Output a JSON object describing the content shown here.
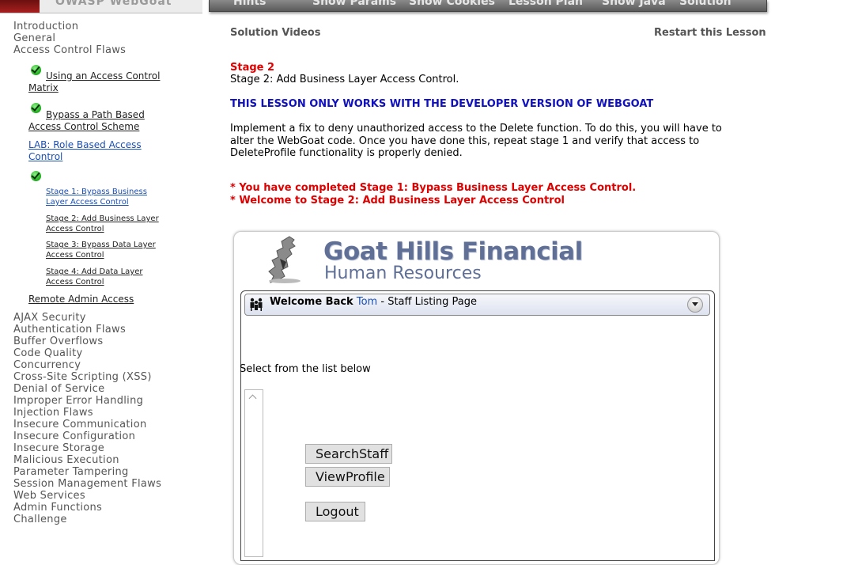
{
  "banner": {
    "top_nav": [
      "Hints",
      "Show Params",
      "Show Cookies",
      "Lesson Plan",
      "Show Java",
      "Solution"
    ]
  },
  "sidebar": {
    "top_items": [
      "Introduction",
      "General",
      "Access Control Flaws"
    ],
    "lessons": [
      "Using an Access Control Matrix",
      "Bypass a Path Based Access Control Scheme",
      "LAB: Role Based Access Control"
    ],
    "stages": [
      "Stage 1: Bypass Business Layer Access Control",
      "Stage 2: Add Business Layer Access Control",
      "Stage 3: Bypass Data Layer Access Control",
      "Stage 4: Add Data Layer Access Control"
    ],
    "remote_admin": "Remote Admin Access",
    "categories": [
      "AJAX Security",
      "Authentication Flaws",
      "Buffer Overflows",
      "Code Quality",
      "Concurrency",
      "Cross-Site Scripting (XSS)",
      "Denial of Service",
      "Improper Error Handling",
      "Injection Flaws",
      "Insecure Communication",
      "Insecure Configuration",
      "Insecure Storage",
      "Malicious Execution",
      "Parameter Tampering",
      "Session Management Flaws",
      "Web Services",
      "Admin Functions",
      "Challenge"
    ]
  },
  "main": {
    "solution_videos": "Solution Videos",
    "restart": "Restart this Lesson",
    "stage_title": "Stage 2",
    "stage_desc": "Stage 2: Add Business Layer Access Control.",
    "dev_warning": "THIS LESSON ONLY WORKS WITH THE DEVELOPER VERSION OF WEBGOAT",
    "instructions": [
      "Implement a fix to deny unauthorized access to the Delete function. To do this, you will have to",
      "alter the WebGoat code. Once you have done this, repeat stage 1 and verify that access to",
      "DeleteProfile functionality is properly denied."
    ],
    "completed_msg": "* You have completed Stage 1: Bypass Business Layer Access Control.",
    "welcome_msg": "* Welcome to Stage 2: Add Business Layer Access Control"
  },
  "app": {
    "brand_title": "Goat Hills Financial",
    "brand_sub": "Human Resources",
    "welcome_back": "Welcome Back",
    "user": "Tom",
    "sep": " - ",
    "page": "Staff Listing Page",
    "select_label": "Select from the list below",
    "buttons": {
      "search": "SearchStaff",
      "view": "ViewProfile",
      "logout": "Logout"
    }
  },
  "colors": {
    "accent_red": "#e00000",
    "link_blue": "#1a4fb5",
    "warning_blue": "#1010c0",
    "brand": "#5f6f96"
  },
  "icons": [
    "checkmark-icon",
    "people-icon",
    "collapse-icon",
    "scroll-up-icon"
  ]
}
